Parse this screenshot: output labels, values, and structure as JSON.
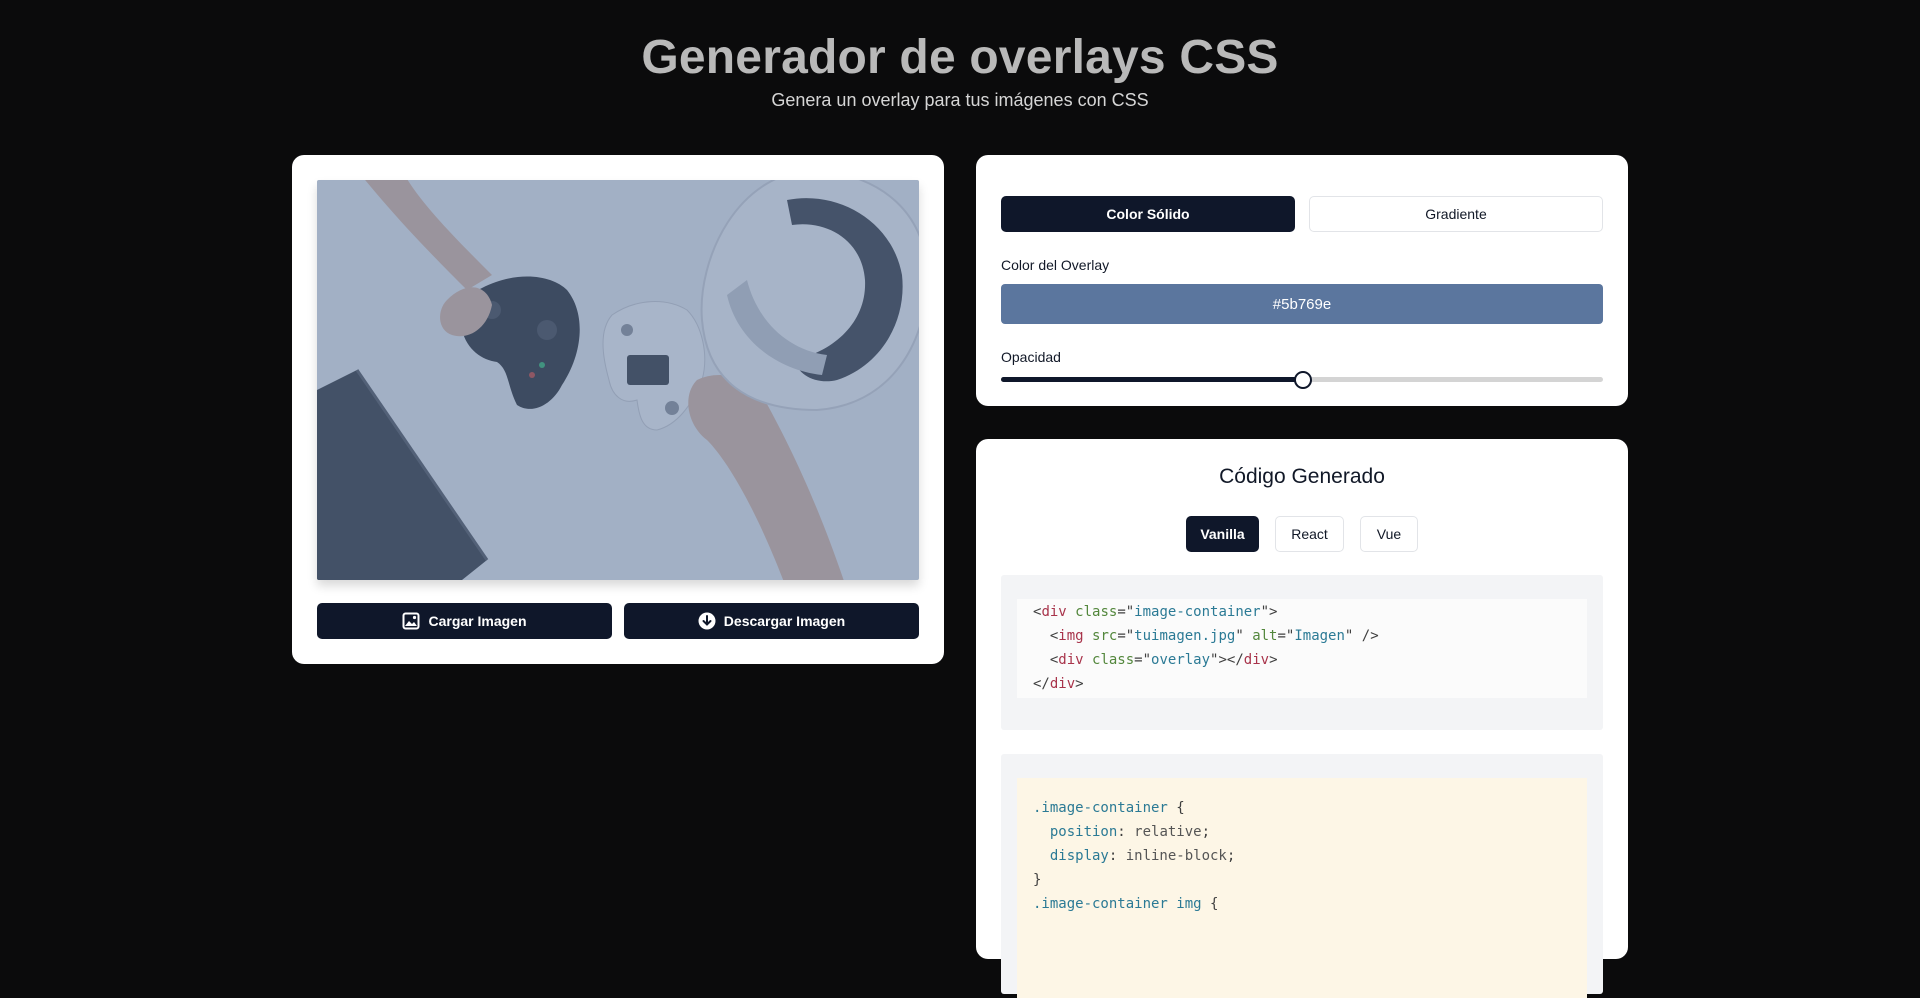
{
  "header": {
    "title": "Generador de overlays CSS",
    "subtitle": "Genera un overlay para tus imágenes con CSS"
  },
  "image_card": {
    "load_button": "Cargar Imagen",
    "download_button": "Descargar Imagen",
    "load_icon": "image-icon",
    "download_icon": "arrow-down-circle-icon"
  },
  "controls": {
    "mode_solid": "Color Sólido",
    "mode_gradient": "Gradiente",
    "active_mode": "Color Sólido",
    "color_label": "Color del Overlay",
    "color_value": "#5b769e",
    "opacity_label": "Opacidad",
    "opacity_value": 0.5
  },
  "code": {
    "title": "Código Generado",
    "frameworks": [
      "Vanilla",
      "React",
      "Vue"
    ],
    "active_framework": "Vanilla",
    "html_lines": [
      [
        {
          "t": "<",
          "c": "punct"
        },
        {
          "t": "div",
          "c": "tag"
        },
        {
          "t": " class",
          "c": "attr"
        },
        {
          "t": "=\"",
          "c": "punct"
        },
        {
          "t": "image-container",
          "c": "str"
        },
        {
          "t": "\">",
          "c": "punct"
        }
      ],
      [
        {
          "t": "  <",
          "c": "punct"
        },
        {
          "t": "img",
          "c": "tag"
        },
        {
          "t": " src",
          "c": "attr"
        },
        {
          "t": "=\"",
          "c": "punct"
        },
        {
          "t": "tuimagen.jpg",
          "c": "str"
        },
        {
          "t": "\"",
          "c": "punct"
        },
        {
          "t": " alt",
          "c": "attr"
        },
        {
          "t": "=\"",
          "c": "punct"
        },
        {
          "t": "Imagen",
          "c": "str"
        },
        {
          "t": "\" />",
          "c": "punct"
        }
      ],
      [
        {
          "t": "  <",
          "c": "punct"
        },
        {
          "t": "div",
          "c": "tag"
        },
        {
          "t": " class",
          "c": "attr"
        },
        {
          "t": "=\"",
          "c": "punct"
        },
        {
          "t": "overlay",
          "c": "str"
        },
        {
          "t": "\"></",
          "c": "punct"
        },
        {
          "t": "div",
          "c": "tag"
        },
        {
          "t": ">",
          "c": "punct"
        }
      ],
      [
        {
          "t": "</",
          "c": "punct"
        },
        {
          "t": "div",
          "c": "tag"
        },
        {
          "t": ">",
          "c": "punct"
        }
      ]
    ],
    "css_lines": [
      [
        {
          "t": ".image-container",
          "c": "sel"
        },
        {
          "t": " {",
          "c": "punct"
        }
      ],
      [
        {
          "t": "  position",
          "c": "prop"
        },
        {
          "t": ": ",
          "c": "punct"
        },
        {
          "t": "relative",
          "c": "val"
        },
        {
          "t": ";",
          "c": "punct"
        }
      ],
      [
        {
          "t": "  display",
          "c": "prop"
        },
        {
          "t": ": ",
          "c": "punct"
        },
        {
          "t": "inline-block",
          "c": "val"
        },
        {
          "t": ";",
          "c": "punct"
        }
      ],
      [
        {
          "t": "}",
          "c": "punct"
        }
      ],
      [
        {
          "t": ".image-container img",
          "c": "sel"
        },
        {
          "t": " {",
          "c": "punct"
        }
      ]
    ]
  },
  "colors": {
    "page_background": "#0b0b0c",
    "primary_dark": "#0f172a",
    "overlay": "#5b769e"
  }
}
